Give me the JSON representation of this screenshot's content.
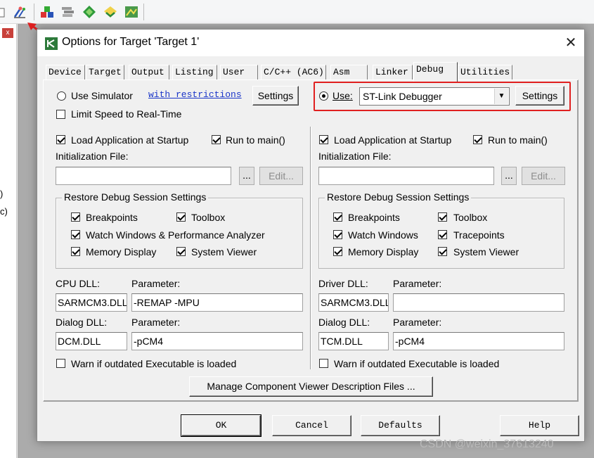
{
  "toolbar": {
    "icons": [
      "checkbox-icon",
      "options-for-target-icon",
      "manage-project-items-icon",
      "batch-build-icon",
      "select-packs-icon",
      "pack-installer-icon",
      "manage-components-icon"
    ]
  },
  "left_panel": {
    "line1": ")",
    "line2": "c)"
  },
  "dialog": {
    "title": "Options for Target 'Target 1'",
    "tabs": [
      "Device",
      "Target",
      "Output",
      "Listing",
      "User",
      "C/C++ (AC6)",
      "Asm",
      "Linker",
      "Debug",
      "Utilities"
    ],
    "active_tab": "Debug",
    "left": {
      "use_simulator_label": "Use Simulator",
      "restrictions_link": "with restrictions",
      "settings_label": "Settings",
      "limit_speed_label": "Limit Speed to Real-Time",
      "load_app_label": "Load Application at Startup",
      "run_to_main_label": "Run to main()",
      "init_file_label": "Initialization File:",
      "browse_label": "...",
      "edit_label": "Edit...",
      "restore_title": "Restore Debug Session Settings",
      "breakpoints_label": "Breakpoints",
      "toolbox_label": "Toolbox",
      "watch_label": "Watch Windows & Performance Analyzer",
      "memory_label": "Memory Display",
      "system_viewer_label": "System Viewer",
      "cpu_dll_label": "CPU DLL:",
      "parameter_label": "Parameter:",
      "cpu_dll_value": "SARMCM3.DLL",
      "cpu_param_value": "-REMAP -MPU",
      "dialog_dll_label": "Dialog DLL:",
      "dialog_dll_value": "DCM.DLL",
      "dialog_param_value": "-pCM4",
      "warn_label": "Warn if outdated Executable is loaded"
    },
    "right": {
      "use_label": "Use:",
      "debugger_value": "ST-Link Debugger",
      "settings_label": "Settings",
      "load_app_label": "Load Application at Startup",
      "run_to_main_label": "Run to main()",
      "init_file_label": "Initialization File:",
      "browse_label": "...",
      "edit_label": "Edit...",
      "restore_title": "Restore Debug Session Settings",
      "breakpoints_label": "Breakpoints",
      "toolbox_label": "Toolbox",
      "watch_label": "Watch Windows",
      "tracepoints_label": "Tracepoints",
      "memory_label": "Memory Display",
      "system_viewer_label": "System Viewer",
      "driver_dll_label": "Driver DLL:",
      "parameter_label": "Parameter:",
      "driver_dll_value": "SARMCM3.DLL",
      "driver_param_value": "",
      "dialog_dll_label": "Dialog DLL:",
      "dialog_dll_value": "TCM.DLL",
      "dialog_param_value": "-pCM4",
      "warn_label": "Warn if outdated Executable is loaded"
    },
    "manage_viewer_label": "Manage Component Viewer Description Files ...",
    "ok_label": "OK",
    "cancel_label": "Cancel",
    "defaults_label": "Defaults",
    "help_label": "Help"
  },
  "watermark": "CSDN @weixin_37613240",
  "colors": {
    "annotation_red": "#e02020",
    "link_blue": "#1a35c8"
  }
}
